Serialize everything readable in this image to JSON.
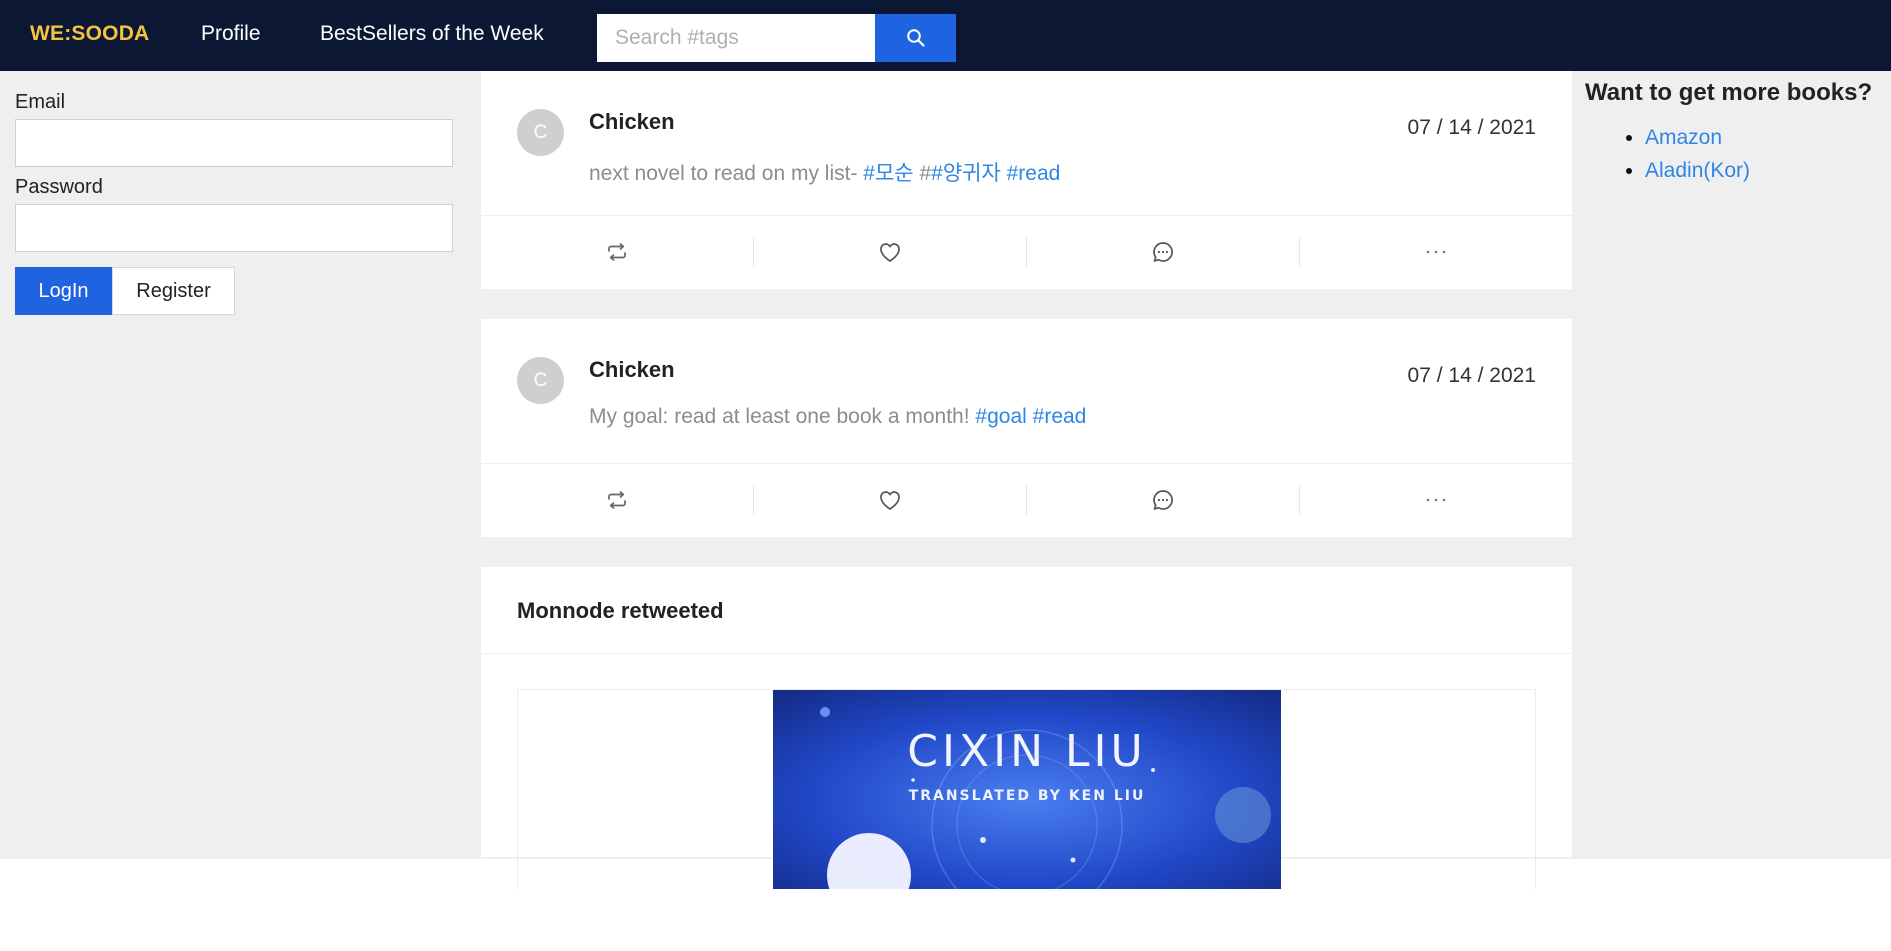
{
  "nav": {
    "brand": "WE:SOODA",
    "links": [
      "Profile",
      "BestSellers of the Week"
    ],
    "search_placeholder": "Search #tags"
  },
  "login": {
    "email_label": "Email",
    "password_label": "Password",
    "login_label": "LogIn",
    "register_label": "Register"
  },
  "posts": [
    {
      "avatar": "C",
      "name": "Chicken",
      "date": "07 / 14 / 2021",
      "text": "next novel to read on my list- ",
      "tags": [
        "#모순",
        " #",
        "#양귀자",
        " ",
        "#read"
      ]
    },
    {
      "avatar": "C",
      "name": "Chicken",
      "date": "07 / 14 / 2021",
      "text": "My goal: read at least one book a month! ",
      "tags": [
        "#goal",
        " ",
        "#read"
      ]
    }
  ],
  "retweet": {
    "title": "Monnode retweeted",
    "cover_author": "CIXIN LIU",
    "cover_translator": "TRANSLATED BY KEN LIU"
  },
  "sidebar": {
    "title": "Want to get more books?",
    "links": [
      "Amazon",
      "Aladin(Kor)"
    ]
  },
  "colors": {
    "navbar": "#0c1833",
    "brand": "#f5c242",
    "primary": "#1e64e0",
    "tag": "#2f86e5",
    "page_bg": "#efefef"
  },
  "icons": [
    "search-icon",
    "retweet-icon",
    "heart-icon",
    "comment-icon",
    "more-icon"
  ]
}
